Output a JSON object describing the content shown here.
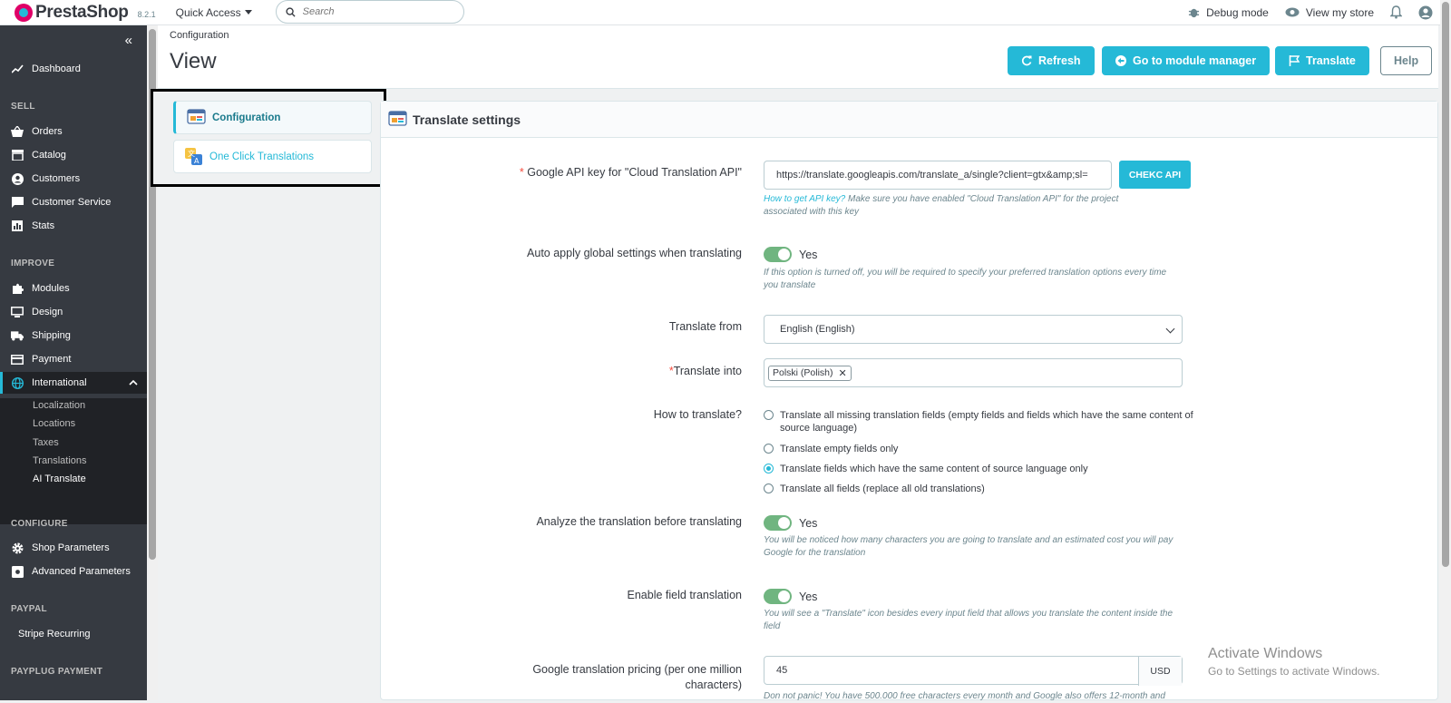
{
  "topbar": {
    "brand": "PrestaShop",
    "version": "8.2.1",
    "quick_access": "Quick Access",
    "search_placeholder": "Search",
    "debug_mode": "Debug mode",
    "view_store": "View my store"
  },
  "sidebar": {
    "dashboard": "Dashboard",
    "sell_head": "SELL",
    "orders": "Orders",
    "catalog": "Catalog",
    "customers": "Customers",
    "customer_service": "Customer Service",
    "stats": "Stats",
    "improve_head": "IMPROVE",
    "modules": "Modules",
    "design": "Design",
    "shipping": "Shipping",
    "payment": "Payment",
    "international": "International",
    "sub": [
      "Localization",
      "Locations",
      "Taxes",
      "Translations",
      "AI Translate"
    ],
    "configure_head": "CONFIGURE",
    "shop_parameters": "Shop Parameters",
    "advanced_parameters": "Advanced Parameters",
    "paypal_head": "PAYPAL",
    "stripe": "Stripe Recurring",
    "payplug_head": "PAYPLUG PAYMENT"
  },
  "header": {
    "breadcrumb": "Configuration",
    "title": "View",
    "refresh": "Refresh",
    "module_manager": "Go to module manager",
    "translate": "Translate",
    "help": "Help"
  },
  "tabs": {
    "configuration": "Configuration",
    "one_click": "One Click Translations"
  },
  "panel": {
    "title": "Translate settings",
    "api_label": "Google API key for \"Cloud Translation API\"",
    "api_value": "https://translate.googleapis.com/translate_a/single?client=gtx&amp;sl=",
    "check_api": "CHEKC API",
    "api_help_link": "How to get API key?",
    "api_help_line1": " Make sure you have enabled \"Cloud Translation API\" for the project",
    "api_help_line2": "associated with this key",
    "auto_label": "Auto apply global settings when translating",
    "yes": "Yes",
    "auto_help_line1": "If this option is turned off, you will be required to specify your preferred translation options every time",
    "auto_help_line2": "you translate",
    "from_label": "Translate from",
    "from_value": "English (English)",
    "into_label": "Translate into",
    "into_tag": "Polski (Polish)",
    "how_label": "How to translate?",
    "radio1_line1": "Translate all missing translation fields (empty fields and fields which have the same content of",
    "radio1_line2": "source language)",
    "radio2": "Translate empty fields only",
    "radio3": "Translate fields which have the same content of source language only",
    "radio4": "Translate all fields (replace all old translations)",
    "analyze_label": "Analyze the translation before translating",
    "analyze_help_line1": "You will be noticed how many characters you are going to translate and an estimated cost you will pay",
    "analyze_help_line2": "Google for the translation",
    "field_label": "Enable field translation",
    "field_help_line1": "You will see a \"Translate\" icon besides every input field that allows you translate the content inside the",
    "field_help_line2": "field",
    "pricing_label_line1": "Google translation pricing (per one million",
    "pricing_label_line2": "characters)",
    "pricing_value": "45",
    "pricing_unit": "USD",
    "pricing_help": "Don not panic! You have 500.000 free characters every month and Google also offers 12-month and"
  },
  "watermark": {
    "line1": "Activate Windows",
    "line2": "Go to Settings to activate Windows."
  }
}
